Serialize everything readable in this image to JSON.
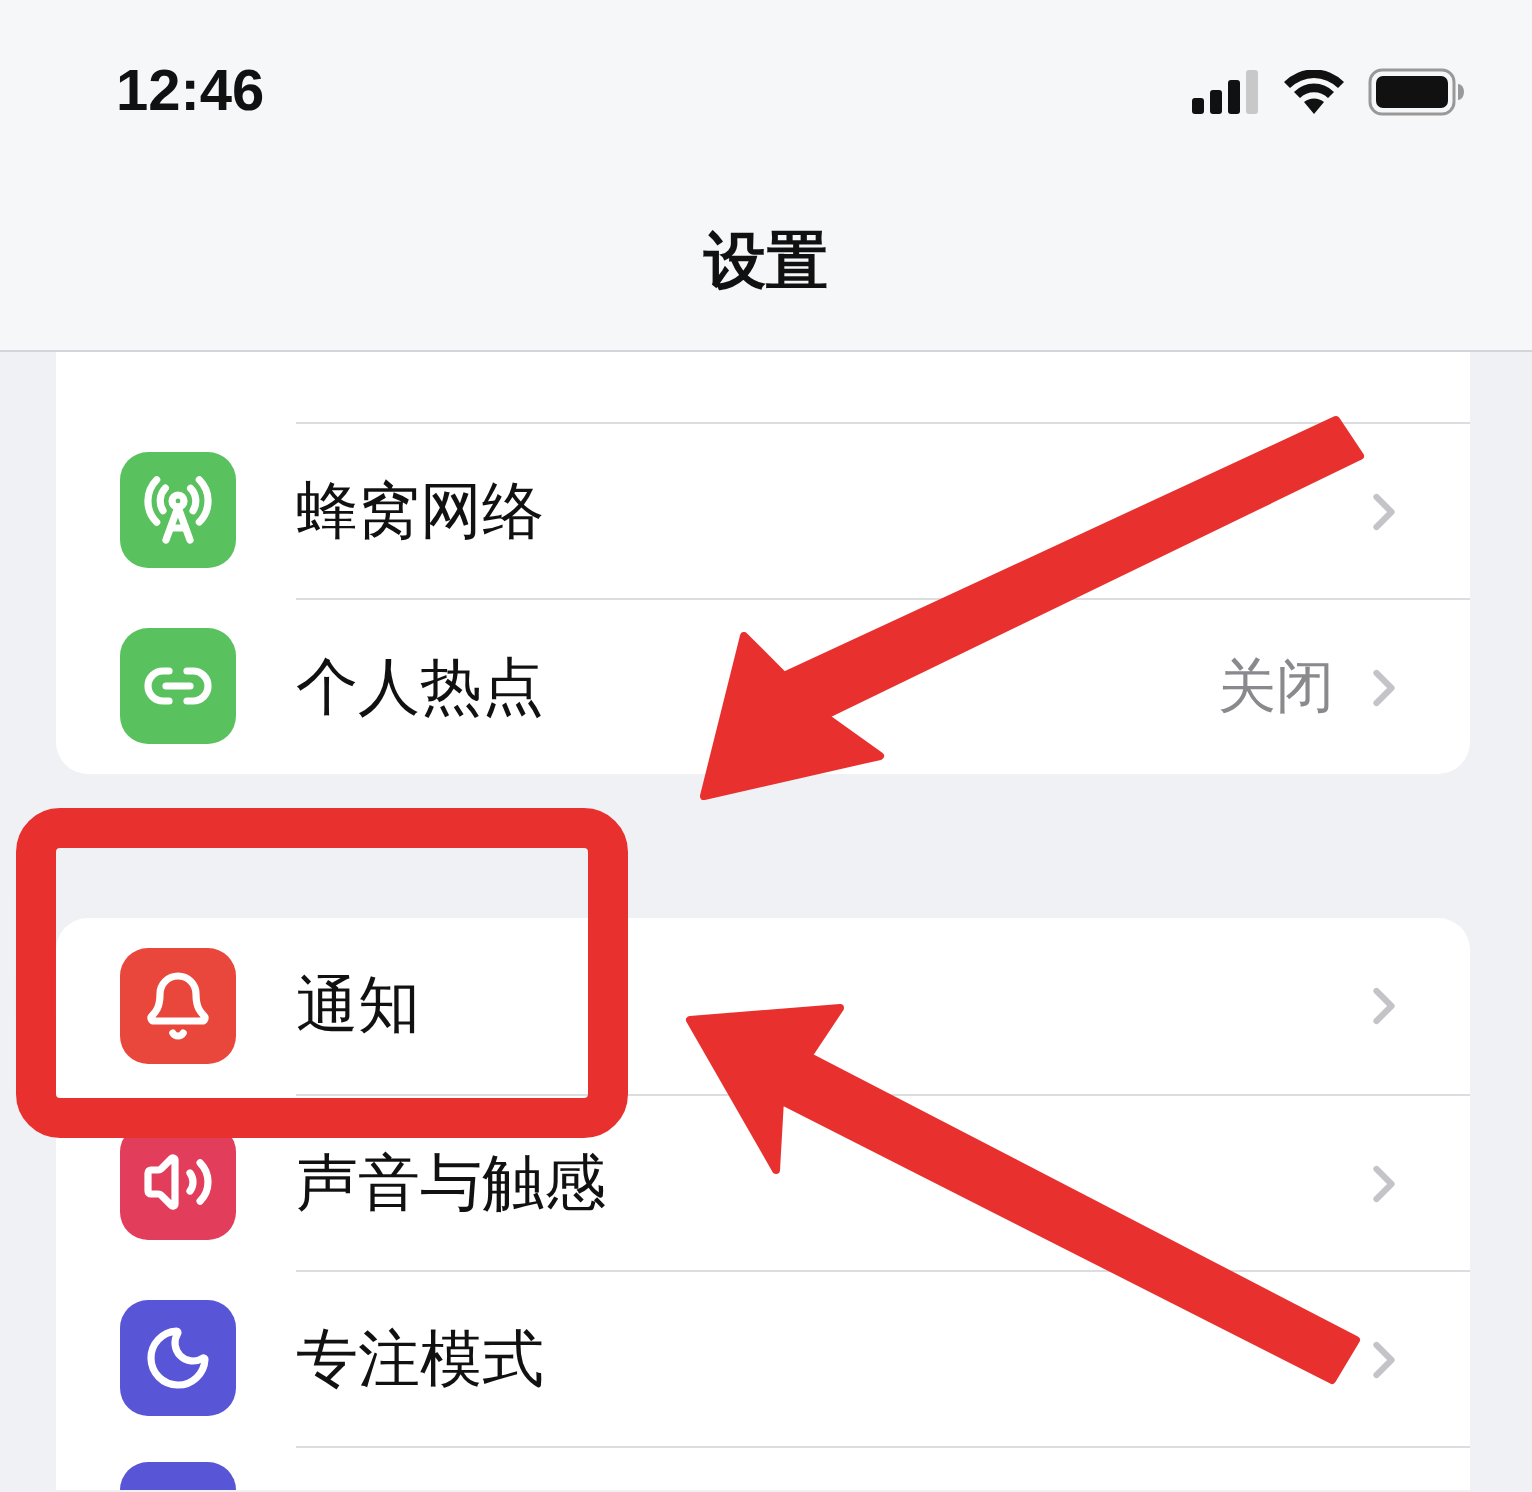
{
  "status_bar": {
    "time": "12:46"
  },
  "nav": {
    "title": "设置"
  },
  "groups": [
    {
      "clipped_above": true,
      "items": [
        {
          "kind": "row",
          "label": "蜂窝网络",
          "color": "#5ac15f"
        },
        {
          "kind": "row",
          "label": "个人热点",
          "value": "关闭",
          "color": "#5ac15f"
        }
      ]
    },
    {
      "clipped_above": false,
      "items": [
        {
          "kind": "row",
          "label": "通知",
          "color": "#e9473b"
        },
        {
          "kind": "row",
          "label": "声音与触感",
          "color": "#e23d5a"
        },
        {
          "kind": "row",
          "label": "专注模式",
          "color": "#5856d6"
        },
        {
          "kind": "clipped",
          "color": "#5856d6"
        }
      ]
    }
  ],
  "annotations": [
    {
      "kind": "frame"
    },
    {
      "kind": "arrow"
    },
    {
      "kind": "arrow"
    }
  ]
}
